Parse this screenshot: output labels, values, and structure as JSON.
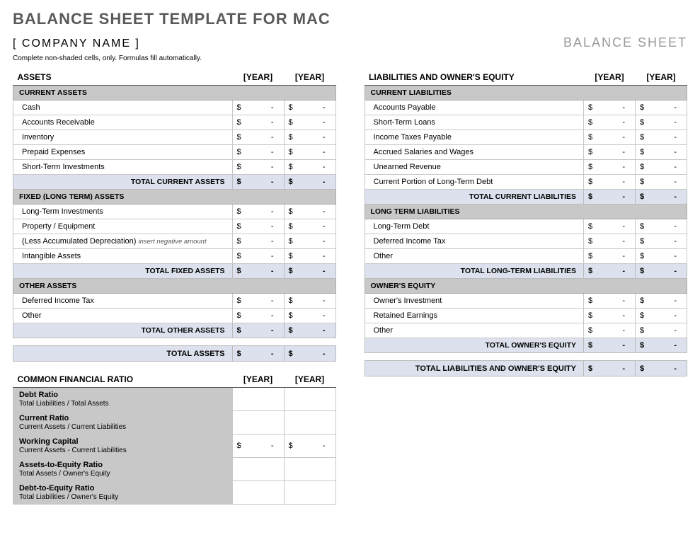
{
  "title": "BALANCE SHEET TEMPLATE FOR MAC",
  "company": "[ COMPANY NAME ]",
  "balance_title": "BALANCE SHEET",
  "instructions": "Complete non-shaded cells, only.  Formulas fill automatically.",
  "year_label": "[YEAR]",
  "dash": "-",
  "currency": "$",
  "assets_header": "ASSETS",
  "current_assets_header": "CURRENT ASSETS",
  "current_assets": [
    "Cash",
    "Accounts Receivable",
    "Inventory",
    "Prepaid Expenses",
    "Short-Term Investments"
  ],
  "total_current_assets": "TOTAL CURRENT ASSETS",
  "fixed_assets_header": "FIXED (LONG TERM) ASSETS",
  "fixed_assets": [
    "Long-Term Investments",
    "Property / Equipment",
    "(Less Accumulated Depreciation)",
    "Intangible Assets"
  ],
  "depr_note": "insert negative amount",
  "total_fixed_assets": "TOTAL FIXED ASSETS",
  "other_assets_header": "OTHER ASSETS",
  "other_assets": [
    "Deferred Income Tax",
    "Other"
  ],
  "total_other_assets": "TOTAL OTHER ASSETS",
  "total_assets": "TOTAL ASSETS",
  "liab_header": "LIABILITIES AND OWNER'S EQUITY",
  "current_liab_header": "CURRENT LIABILITIES",
  "current_liab": [
    "Accounts Payable",
    "Short-Term Loans",
    "Income Taxes Payable",
    "Accrued Salaries and Wages",
    "Unearned Revenue",
    "Current Portion of Long-Term Debt"
  ],
  "total_current_liab": "TOTAL CURRENT LIABILITIES",
  "long_liab_header": "LONG TERM LIABILITIES",
  "long_liab": [
    "Long-Term Debt",
    "Deferred Income Tax",
    "Other"
  ],
  "total_long_liab": "TOTAL LONG-TERM LIABILITIES",
  "equity_header": "OWNER'S EQUITY",
  "equity": [
    "Owner's Investment",
    "Retained Earnings",
    "Other"
  ],
  "total_equity": "TOTAL OWNER'S EQUITY",
  "total_liab_equity": "TOTAL LIABILITIES AND OWNER'S EQUITY",
  "ratio_header": "COMMON FINANCIAL RATIO",
  "ratios": [
    {
      "name": "Debt Ratio",
      "sub": "Total Liabilities / Total Assets",
      "money": false
    },
    {
      "name": "Current Ratio",
      "sub": "Current Assets / Current Liabilities",
      "money": false
    },
    {
      "name": "Working Capital",
      "sub": "Current Assets - Current Liabilities",
      "money": true
    },
    {
      "name": "Assets-to-Equity Ratio",
      "sub": "Total Assets / Owner's Equity",
      "money": false
    },
    {
      "name": "Debt-to-Equity Ratio",
      "sub": "Total Liabilities / Owner's Equity",
      "money": false
    }
  ]
}
